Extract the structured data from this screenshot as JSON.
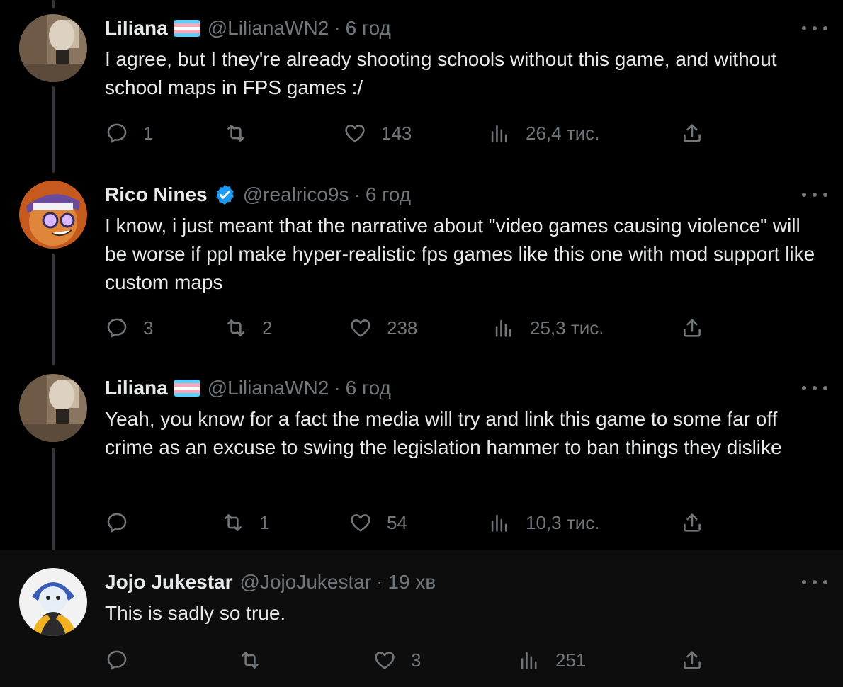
{
  "colors": {
    "background": "#000000",
    "text": "#e7e9ea",
    "muted": "#71767b",
    "verified": "#1d9bf0",
    "thread_line": "#333639"
  },
  "icons": {
    "reply": "reply-icon",
    "retweet": "retweet-icon",
    "like": "heart-icon",
    "views": "bar-chart-icon",
    "share": "share-icon",
    "more": "more-dots-icon",
    "flag": "transgender-flag-icon",
    "verified": "verified-badge-icon"
  },
  "tweets": [
    {
      "name": "Liliana",
      "handle": "@LilianaWN2",
      "dot": "·",
      "time": "6 год",
      "text": "I agree, but I they're already shooting schools without this game, and without school maps in FPS games :/",
      "replies": "1",
      "retweets": "",
      "likes": "143",
      "views": "26,4 тис."
    },
    {
      "name": "Rico Nines",
      "handle": "@realrico9s",
      "dot": "·",
      "time": "6 год",
      "text": "I know, i just meant that the narrative about \"video games causing violence\" will be worse if ppl make hyper-realistic fps games like this one with mod support like custom maps",
      "replies": "3",
      "retweets": "2",
      "likes": "238",
      "views": "25,3 тис."
    },
    {
      "name": "Liliana",
      "handle": "@LilianaWN2",
      "dot": "·",
      "time": "6 год",
      "text": "Yeah, you know for a fact the media will try and link this game to some far off crime as an excuse to swing the legislation hammer to ban things they dislike",
      "replies": "",
      "retweets": "1",
      "likes": "54",
      "views": "10,3 тис."
    },
    {
      "name": "Jojo Jukestar",
      "handle": "@JojoJukestar",
      "dot": "·",
      "time": "19 хв",
      "text": "This is sadly so true.",
      "replies": "",
      "retweets": "",
      "likes": "3",
      "views": "251"
    }
  ]
}
